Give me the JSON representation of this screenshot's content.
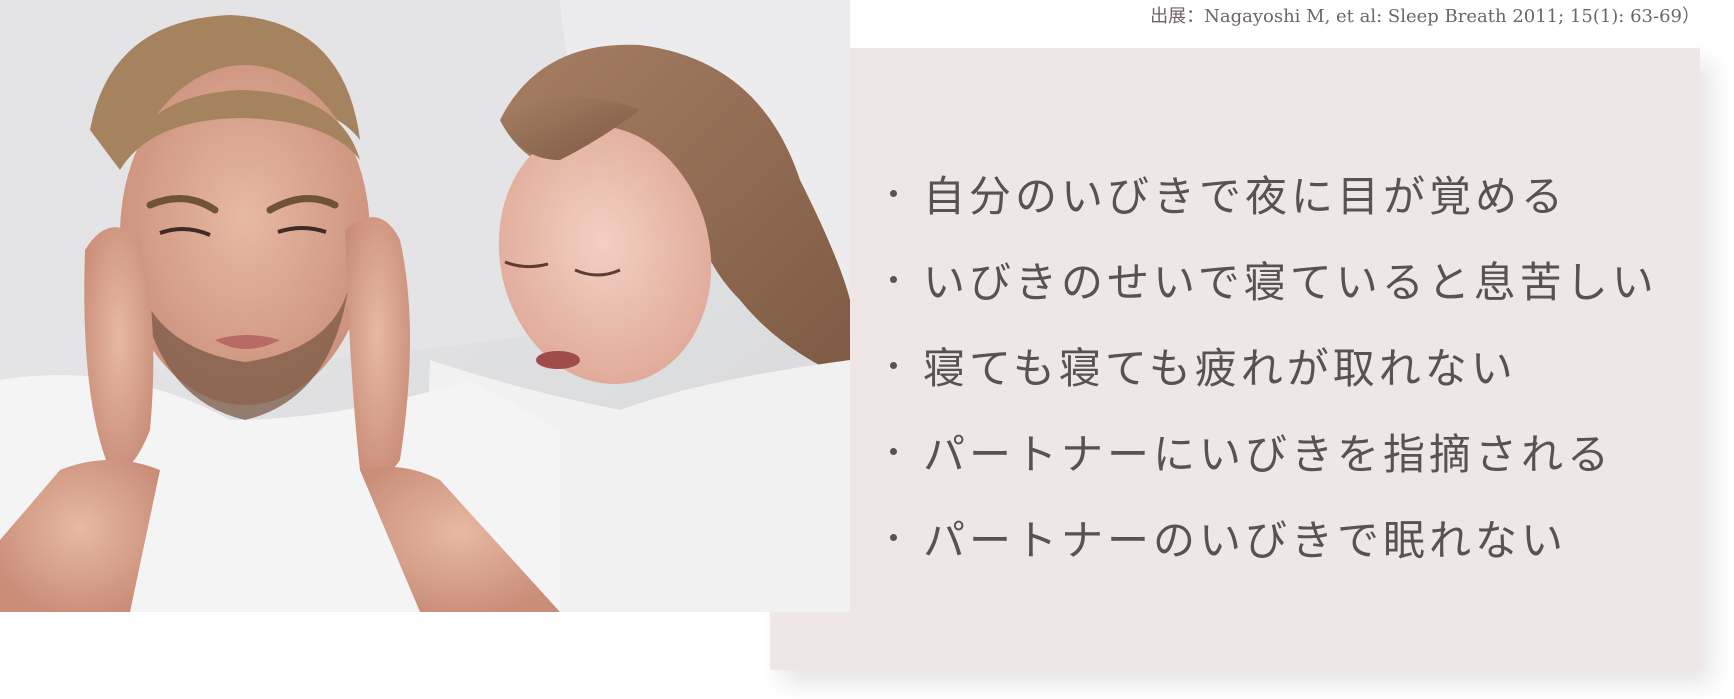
{
  "source_note": "出展：Nagayoshi M, et al: Sleep Breath 2011; 15(1): 63-69）",
  "symptoms": [
    "自分のいびきで夜に目が覚める",
    "いびきのせいで寝ていると息苦しい",
    "寝ても寝ても疲れが取れない",
    "パートナーにいびきを指摘される",
    "パートナーのいびきで眠れない"
  ],
  "colors": {
    "panel_background": "#efe6e6",
    "text": "#575253"
  },
  "image": {
    "description_icon": "couple-in-bed-photo"
  }
}
